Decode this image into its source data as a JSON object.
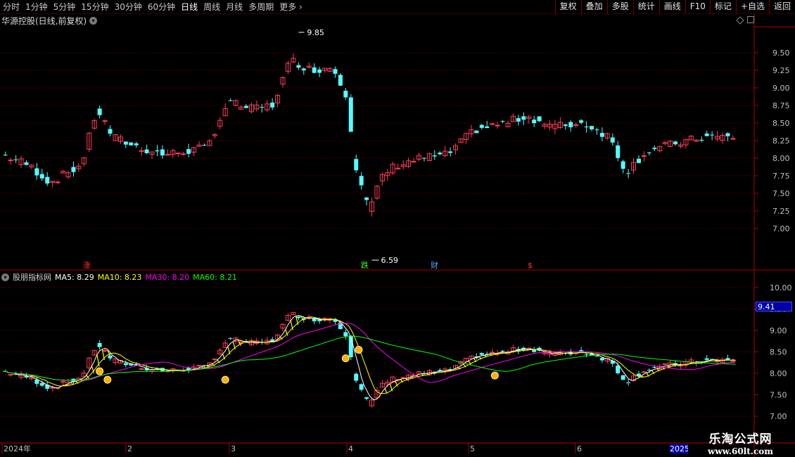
{
  "toolbar": {
    "periods": [
      "分时",
      "1分钟",
      "5分钟",
      "15分钟",
      "30分钟",
      "60分钟",
      "日线",
      "周线",
      "月线",
      "多周期",
      "更多"
    ],
    "active_period": "日线",
    "right_tools": [
      "复权",
      "叠加",
      "多股",
      "统计",
      "画线",
      "F10",
      "标记",
      "+自选",
      "返回"
    ]
  },
  "header": {
    "stock_title": "华源控股(日线,前复权)"
  },
  "main_chart": {
    "y_ticks": [
      "9.50",
      "9.25",
      "9.00",
      "8.75",
      "8.50",
      "8.25",
      "8.00",
      "7.75",
      "7.50",
      "7.25",
      "7.00"
    ],
    "y_tick_values": [
      9.5,
      9.25,
      9.0,
      8.75,
      8.5,
      8.25,
      8.0,
      7.75,
      7.5,
      7.25,
      7.0
    ],
    "high_marker": "9.85",
    "low_marker": "6.59",
    "events": [
      {
        "label": "涨",
        "color": "#ff3030"
      },
      {
        "label": "跌",
        "color": "#30ff30"
      },
      {
        "label": "财",
        "color": "#4aa8ff"
      },
      {
        "label": "$",
        "color": "#ff3030"
      }
    ]
  },
  "indicator": {
    "name": "股朋指标网",
    "ma5": "MA5: 8.29",
    "ma10": "MA10: 8.23",
    "ma30": "MA30: 8.20",
    "ma60": "MA60: 8.21",
    "colors": {
      "ma5": "#ffffff",
      "ma10": "#ffff00",
      "ma30": "#ff00ff",
      "ma60": "#00ff00"
    },
    "y_ticks": [
      "10.00",
      "9.50",
      "9.00",
      "8.50",
      "8.00",
      "7.50",
      "7.00"
    ],
    "y_tick_values": [
      10.0,
      9.5,
      9.0,
      8.5,
      8.0,
      7.5,
      7.0
    ],
    "current_price": "9.41"
  },
  "x_axis": {
    "labels": [
      "2024年",
      "2",
      "3",
      "4",
      "5",
      "6",
      "2025"
    ]
  },
  "watermark": {
    "cn": "乐淘公式网",
    "url": "www.60lt.com"
  },
  "colors": {
    "up": "#ff3c5a",
    "down": "#54ffff",
    "grid": "#8a0000",
    "axis_text": "#c0c0c0"
  }
}
